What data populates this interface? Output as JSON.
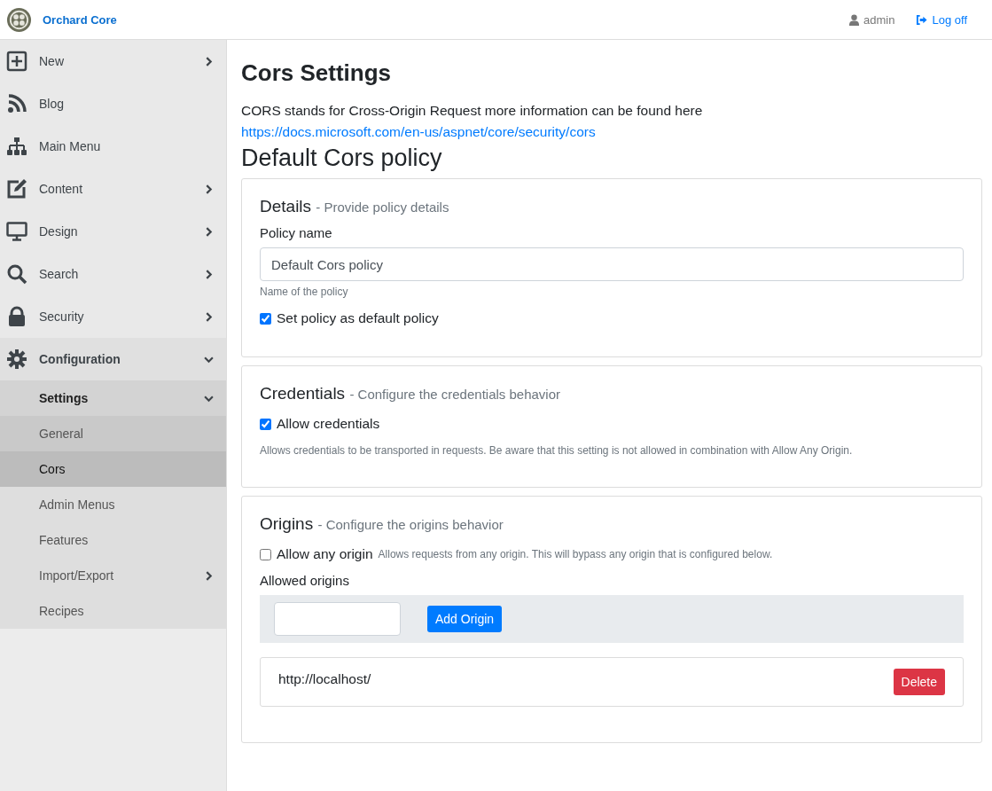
{
  "header": {
    "brand": "Orchard Core",
    "user": "admin",
    "logoff": "Log off"
  },
  "sidebar": {
    "items": [
      {
        "label": "New",
        "expandable": true,
        "expanded": false,
        "selected": false
      },
      {
        "label": "Blog",
        "expandable": false,
        "expanded": false,
        "selected": false
      },
      {
        "label": "Main Menu",
        "expandable": false,
        "expanded": false,
        "selected": false
      },
      {
        "label": "Content",
        "expandable": true,
        "expanded": false,
        "selected": false
      },
      {
        "label": "Design",
        "expandable": true,
        "expanded": false,
        "selected": false
      },
      {
        "label": "Search",
        "expandable": true,
        "expanded": false,
        "selected": false
      },
      {
        "label": "Security",
        "expandable": true,
        "expanded": false,
        "selected": false
      },
      {
        "label": "Configuration",
        "expandable": true,
        "expanded": true,
        "selected": false,
        "children": [
          {
            "label": "Settings",
            "expandable": true,
            "expanded": true,
            "selected": false,
            "children": [
              {
                "label": "General",
                "selected": false
              },
              {
                "label": "Cors",
                "selected": true
              }
            ]
          },
          {
            "label": "Admin Menus",
            "expandable": false,
            "expanded": false,
            "selected": false
          },
          {
            "label": "Features",
            "expandable": false,
            "expanded": false,
            "selected": false
          },
          {
            "label": "Import/Export",
            "expandable": true,
            "expanded": false,
            "selected": false
          },
          {
            "label": "Recipes",
            "expandable": false,
            "expanded": false,
            "selected": false
          }
        ]
      }
    ]
  },
  "page": {
    "title": "Cors Settings",
    "intro": "CORS stands for Cross-Origin Request more information can be found here",
    "intro_link": "https://docs.microsoft.com/en-us/aspnet/core/security/cors",
    "policy_title": "Default Cors policy"
  },
  "details": {
    "title": "Details",
    "subtitle": "- Provide policy details",
    "policy_name_label": "Policy name",
    "policy_name_value": "Default Cors policy",
    "policy_name_hint": "Name of the policy",
    "default_checkbox": {
      "label": "Set policy as default policy",
      "checked": true
    }
  },
  "credentials": {
    "title": "Credentials",
    "subtitle": "- Configure the credentials behavior",
    "checkbox": {
      "label": "Allow credentials",
      "checked": true
    },
    "hint": "Allows credentials to be transported in requests. Be aware that this setting is not allowed in combination with Allow Any Origin."
  },
  "origins": {
    "title": "Origins",
    "subtitle": "- Configure the origins behavior",
    "any_origin": {
      "label": "Allow any origin",
      "checked": false,
      "hint": "Allows requests from any origin. This will bypass any origin that is configured below."
    },
    "allowed_label": "Allowed origins",
    "add_button": "Add Origin",
    "list": [
      {
        "url": "http://localhost/",
        "delete_button": "Delete"
      }
    ]
  }
}
